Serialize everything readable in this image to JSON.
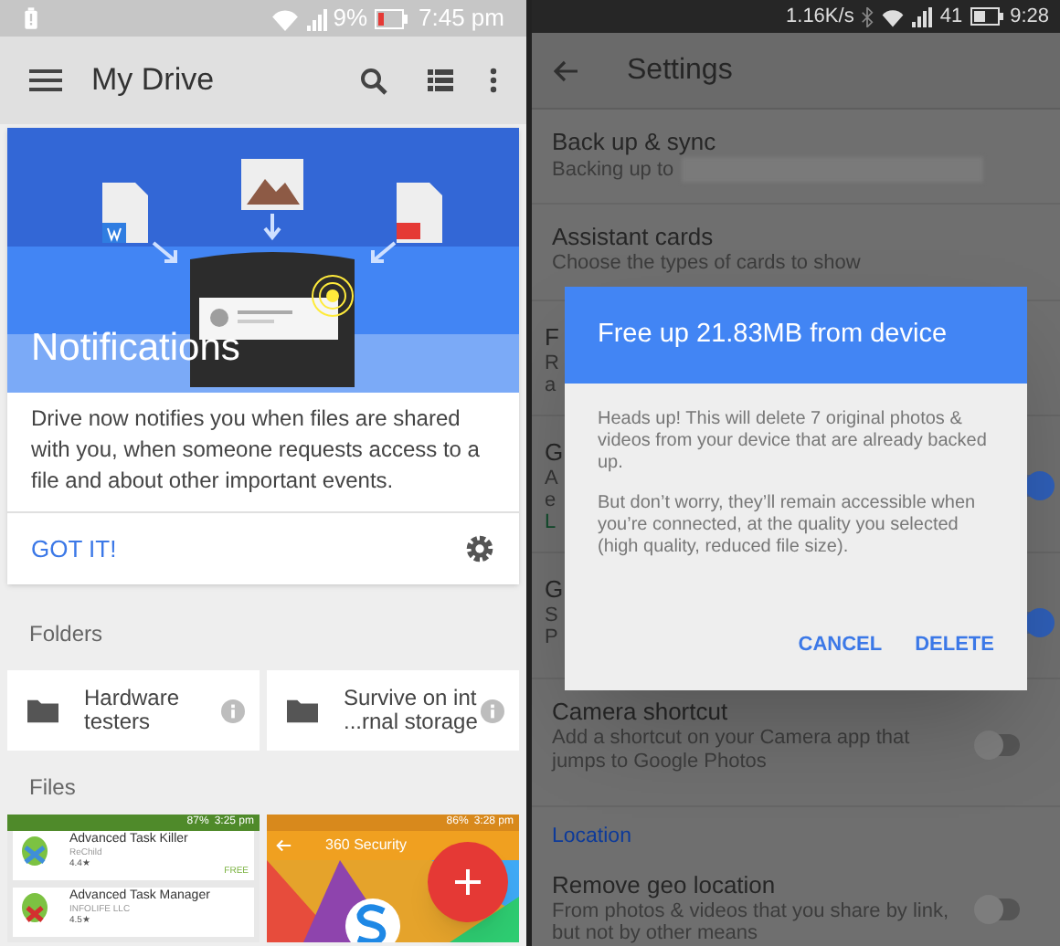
{
  "left_screen": {
    "status_bar": {
      "battery": "9%",
      "time": "7:45 pm"
    },
    "toolbar": {
      "title": "My Drive"
    },
    "notification_card": {
      "title": "Notifications",
      "body": "Drive now notifies you when files are shared with you, when someone requests access to a file and about other important events.",
      "action": "GOT IT!"
    },
    "folders_heading": "Folders",
    "folders": [
      {
        "lines": [
          "Hardware",
          "testers"
        ]
      },
      {
        "lines": [
          "Survive on int",
          "...rnal storage"
        ]
      }
    ],
    "files_heading": "Files",
    "files": [
      {
        "kind": "app-list",
        "status_battery": "87%",
        "status_time": "3:25 pm",
        "apps": [
          {
            "name": "Advanced Task Killer",
            "developer": "ReChild",
            "rating": "4.4★",
            "price": "FREE"
          },
          {
            "name": "Advanced Task Manager",
            "developer": "INFOLIFE LLC",
            "rating": "4.5★"
          }
        ]
      },
      {
        "kind": "security",
        "status_battery": "86%",
        "status_time": "3:28 pm",
        "title": "360 Security"
      }
    ]
  },
  "right_screen": {
    "status_bar": {
      "speed": "1.16K/s",
      "battery": "41",
      "time": "9:28"
    },
    "toolbar": {
      "title": "Settings"
    },
    "settings": [
      {
        "kind": "item",
        "title": "Back up & sync",
        "subtitle": "Backing up to",
        "redacted": true
      },
      {
        "kind": "item",
        "title": "Assistant cards",
        "subtitle": "Choose the types of cards to show"
      },
      {
        "kind": "covered",
        "fragments": [
          {
            "kind": "title",
            "text": "F"
          },
          {
            "kind": "subtitle",
            "text": "R"
          },
          {
            "kind": "subtitle",
            "text": "a"
          }
        ]
      },
      {
        "kind": "covered",
        "on": true,
        "fragments": [
          {
            "kind": "title",
            "text": "G"
          },
          {
            "kind": "subtitle",
            "text": "A"
          },
          {
            "kind": "subtitle",
            "text": "e"
          },
          {
            "kind": "link",
            "text": "L"
          }
        ]
      },
      {
        "kind": "covered",
        "on": true,
        "fragments": [
          {
            "kind": "title",
            "text": "G"
          },
          {
            "kind": "subtitle",
            "text": "S"
          },
          {
            "kind": "subtitle",
            "text": "P"
          }
        ]
      },
      {
        "kind": "item",
        "title": "Camera shortcut",
        "subtitle": "Add a shortcut on your Camera app that jumps to Google Photos",
        "on": false
      },
      {
        "kind": "section",
        "title": "Location"
      },
      {
        "kind": "item",
        "title": "Remove geo location",
        "subtitle": "From photos & videos that you share by link, but not by other means",
        "on": false
      }
    ],
    "dialog": {
      "title": "Free up 21.83MB from device",
      "paragraphs": [
        "Heads up! This will delete 7 original photos & videos from your device that are already backed up.",
        "But don’t worry, they’ll remain accessible when you’re connected, at the quality you selected (high quality, reduced file size)."
      ],
      "buttons": [
        "CANCEL",
        "DELETE"
      ]
    }
  }
}
